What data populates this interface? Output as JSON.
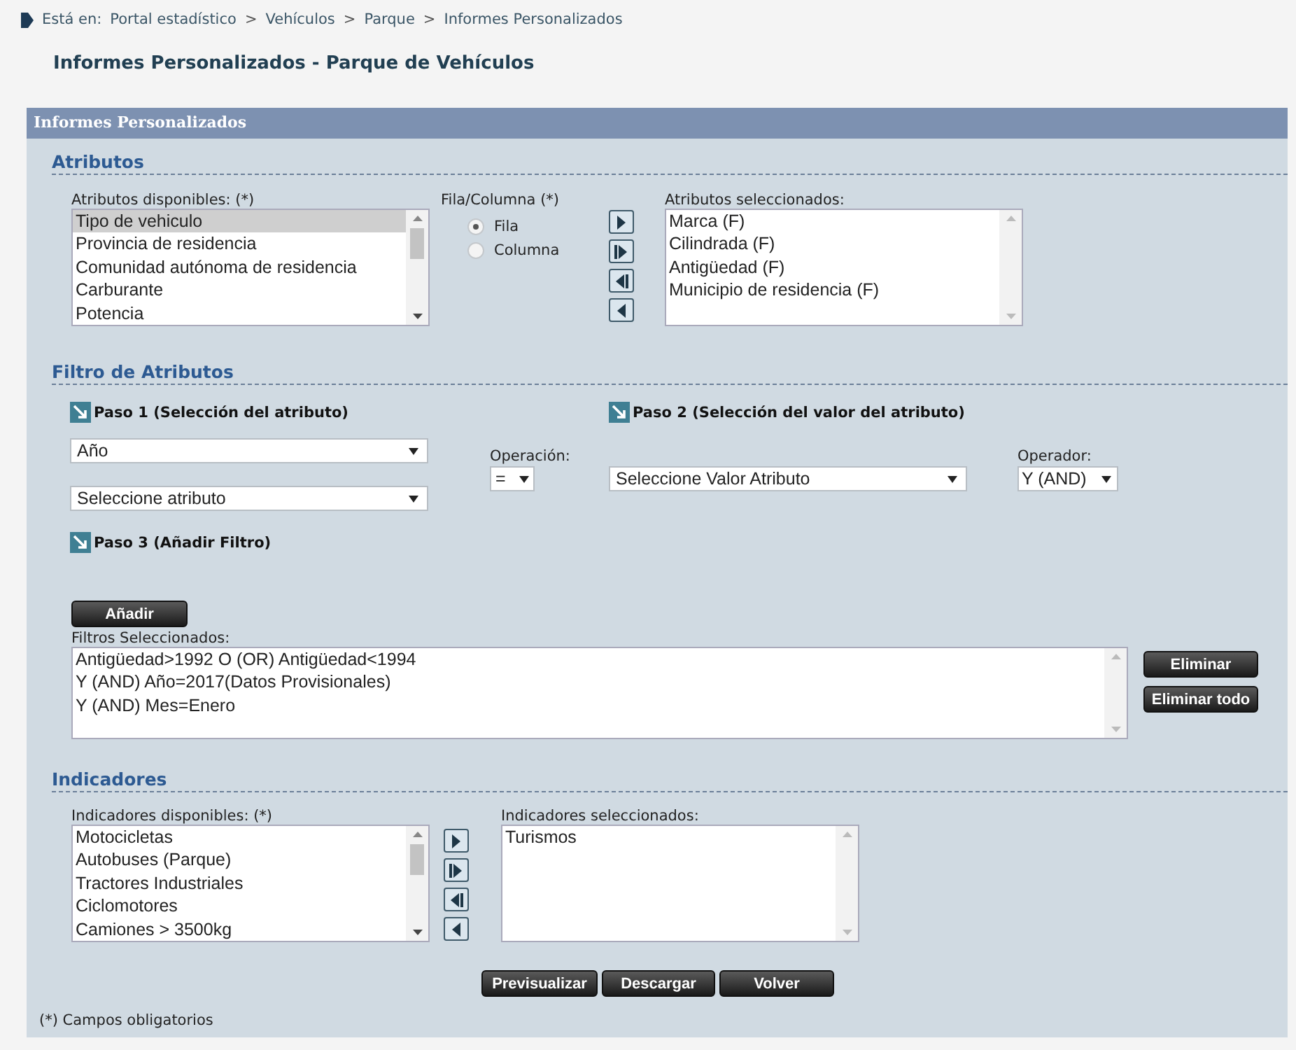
{
  "breadcrumb": [
    {
      "kind": "label",
      "text": "Está en:"
    },
    {
      "kind": "link",
      "text": "Portal estadístico"
    },
    {
      "kind": "separator",
      "text": ">"
    },
    {
      "kind": "link",
      "text": "Vehículos"
    },
    {
      "kind": "separator",
      "text": ">"
    },
    {
      "kind": "link",
      "text": "Parque"
    },
    {
      "kind": "separator",
      "text": ">"
    },
    {
      "kind": "link",
      "text": "Informes Personalizados"
    }
  ],
  "page_title": "Informes Personalizados - Parque de Vehículos",
  "panel": {
    "title": "Informes Personalizados",
    "atributos": {
      "heading": "Atributos",
      "available": {
        "label": "Atributos disponibles: (*)",
        "scrollable": true,
        "items": [
          {
            "text": "Tipo de vehiculo",
            "selected": true
          },
          {
            "text": "Provincia de residencia",
            "selected": false
          },
          {
            "text": "Comunidad autónoma de residencia",
            "selected": false
          },
          {
            "text": "Carburante",
            "selected": false
          },
          {
            "text": "Potencia",
            "selected": false
          }
        ]
      },
      "orientation": {
        "label": "Fila/Columna (*)",
        "options": [
          {
            "text": "Fila",
            "selected": true
          },
          {
            "text": "Columna",
            "selected": false
          }
        ]
      },
      "selected": {
        "label": "Atributos seleccionados:",
        "scrollable": false,
        "items": [
          {
            "text": "Marca (F)",
            "selected": false
          },
          {
            "text": "Cilindrada (F)",
            "selected": false
          },
          {
            "text": "Antigüedad (F)",
            "selected": false
          },
          {
            "text": "Municipio de residencia (F)",
            "selected": false
          }
        ]
      }
    },
    "filtro": {
      "heading": "Filtro de Atributos",
      "step1": "Paso 1 (Selección del atributo)",
      "attribute_select": {
        "value": "Año"
      },
      "subattribute_select": {
        "value": "Seleccione atributo"
      },
      "operation": {
        "label": "Operación:",
        "value": "="
      },
      "step2": "Paso 2 (Selección del valor del atributo)",
      "value_select": {
        "value": "Seleccione Valor Atributo"
      },
      "operator": {
        "label": "Operador:",
        "value": "Y (AND)"
      },
      "step3": "Paso 3 (Añadir Filtro)",
      "add_button": "Añadir",
      "filters": {
        "label": "Filtros Seleccionados:",
        "scrollable": false,
        "items": [
          {
            "text": "Antigüedad>1992 O (OR) Antigüedad<1994",
            "selected": false
          },
          {
            "text": "Y (AND) Año=2017(Datos Provisionales)",
            "selected": false
          },
          {
            "text": "Y (AND) Mes=Enero",
            "selected": false
          }
        ]
      },
      "delete_button": "Eliminar",
      "delete_all_button": "Eliminar todo"
    },
    "indicadores": {
      "heading": "Indicadores",
      "available": {
        "label": "Indicadores disponibles: (*)",
        "scrollable": true,
        "items": [
          {
            "text": "Motocicletas",
            "selected": false
          },
          {
            "text": "Autobuses (Parque)",
            "selected": false
          },
          {
            "text": "Tractores Industriales",
            "selected": false
          },
          {
            "text": "Ciclomotores",
            "selected": false
          },
          {
            "text": "Camiones > 3500kg",
            "selected": false
          }
        ]
      },
      "selected": {
        "label": "Indicadores seleccionados:",
        "scrollable": false,
        "items": [
          {
            "text": "Turismos",
            "selected": false
          }
        ]
      }
    },
    "actions": [
      "Previsualizar",
      "Descargar",
      "Volver"
    ],
    "footnote": "(*) Campos obligatorios"
  }
}
